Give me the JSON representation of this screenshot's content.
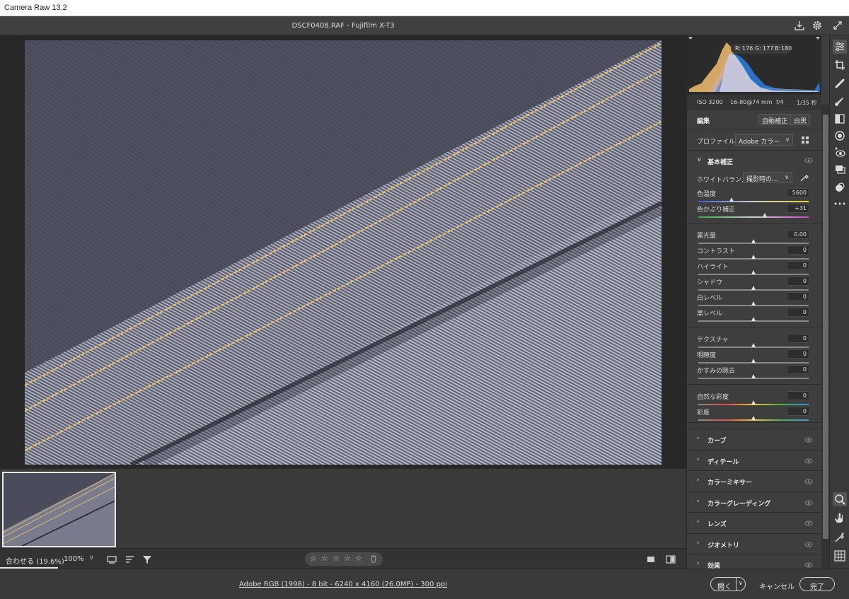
{
  "window": {
    "title": "Camera Raw 13.2"
  },
  "file": {
    "title": "DSCF0408.RAF  -  Fujifilm X-T3"
  },
  "histogram": {
    "r_label": "R:",
    "r": "176",
    "g_label": "G:",
    "g": "177",
    "b_label": "B:",
    "b": "180"
  },
  "exif": {
    "iso": "ISO 3200",
    "lens": "16-80@74 mm",
    "aperture": "f/4",
    "shutter": "1/35 秒"
  },
  "edit": {
    "title": "編集",
    "auto": "自動補正",
    "bw": "白黒",
    "profile_label": "プロファイル",
    "profile_value": "Adobe カラー"
  },
  "basic": {
    "title": "基本補正",
    "wb_label": "ホワイトバランス",
    "wb_value": "撮影時の...",
    "sliders": [
      {
        "label": "色温度",
        "value": "5600",
        "pos": 0.3
      },
      {
        "label": "色かぶり補正",
        "value": "+31",
        "pos": 0.6
      },
      {
        "label": "露光量",
        "value": "0.00",
        "pos": 0.5
      },
      {
        "label": "コントラスト",
        "value": "0",
        "pos": 0.5
      },
      {
        "label": "ハイライト",
        "value": "0",
        "pos": 0.5
      },
      {
        "label": "シャドウ",
        "value": "0",
        "pos": 0.5
      },
      {
        "label": "白レベル",
        "value": "0",
        "pos": 0.5
      },
      {
        "label": "黒レベル",
        "value": "0",
        "pos": 0.5
      },
      {
        "label": "テクスチャ",
        "value": "0",
        "pos": 0.5
      },
      {
        "label": "明瞭度",
        "value": "0",
        "pos": 0.5
      },
      {
        "label": "かすみの除去",
        "value": "0",
        "pos": 0.5
      },
      {
        "label": "自然な彩度",
        "value": "0",
        "pos": 0.5
      },
      {
        "label": "彩度",
        "value": "0",
        "pos": 0.5
      }
    ]
  },
  "sections": [
    {
      "label": "カーブ"
    },
    {
      "label": "ディテール"
    },
    {
      "label": "カラーミキサー"
    },
    {
      "label": "カラーグレーディング"
    },
    {
      "label": "レンズ"
    },
    {
      "label": "ジオメトリ"
    },
    {
      "label": "効果"
    }
  ],
  "status": {
    "fit": "合わせる (19.6%)",
    "zoom": "100%",
    "zoom_arrow": "∨"
  },
  "rating": {
    "stars": "☆",
    "trash": "🗑"
  },
  "bottom": {
    "info": "Adobe RGB (1998) - 8 bit - 6240 x 4160 (26.0MP) - 300 ppi",
    "open": "開く",
    "cancel": "キャンセル",
    "done": "完了"
  },
  "colors": {
    "accent": "#2d7ce0",
    "thread": "#e8c06a",
    "denim_dark": "#4a4c5a"
  }
}
